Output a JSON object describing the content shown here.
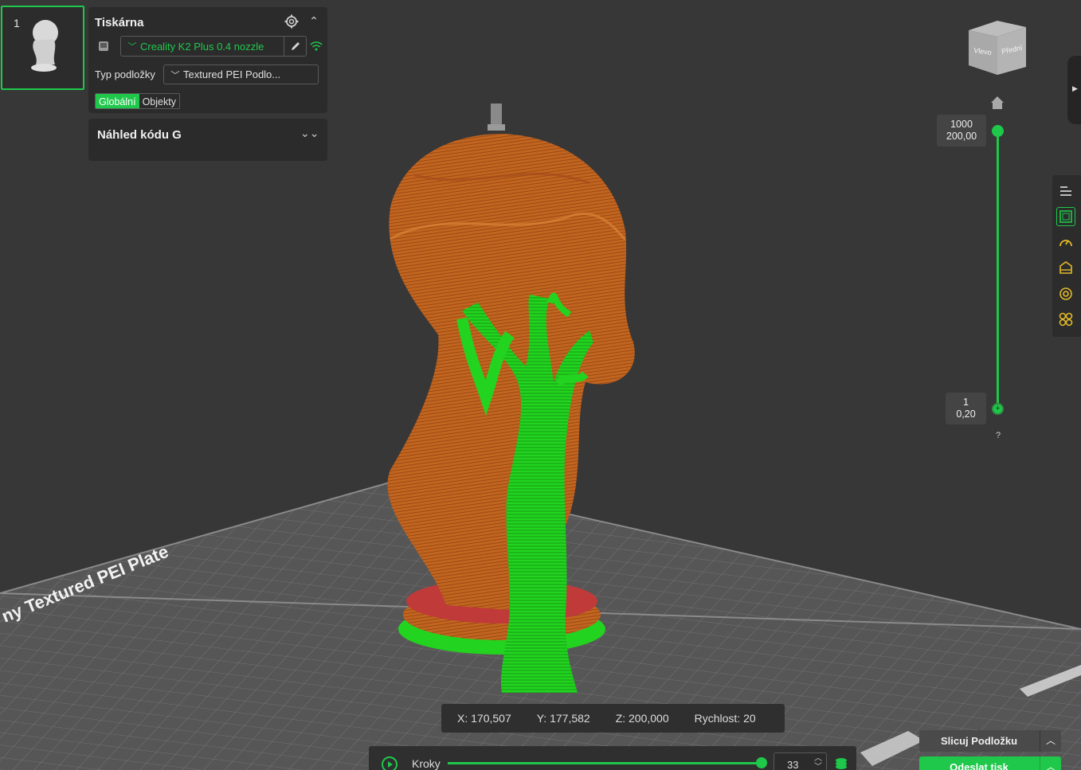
{
  "plate": {
    "number": "1"
  },
  "printer_panel": {
    "title": "Tiskárna",
    "printer_name": "Creality K2 Plus 0.4 nozzle",
    "plate_type_label": "Typ podložky",
    "plate_type_value": "Textured PEI Podlo...",
    "toggle_global": "Globální",
    "toggle_objects": "Objekty"
  },
  "gcode_panel": {
    "title": "Náhled kódu G"
  },
  "view_cube": {
    "left_face": "Vlevo",
    "front_face": "Přední"
  },
  "layer_slider": {
    "top_layer": "1000",
    "top_height": "200,00",
    "bottom_layer": "1",
    "bottom_height": "0,20",
    "help": "?"
  },
  "bed_label": "ny Textured PEI Plate",
  "status": {
    "x": "X: 170,507",
    "y": "Y: 177,582",
    "z": "Z: 200,000",
    "speed": "Rychlost: 20"
  },
  "steps": {
    "label": "Kroky",
    "value": "33",
    "progress": 1.0
  },
  "buttons": {
    "slice": "Slicuj Podložku",
    "send": "Odeslat tisk"
  },
  "colors": {
    "accent": "#1fc84a",
    "model": "#c56a26",
    "support": "#1ed31e",
    "bed": "#5a5a5b"
  }
}
